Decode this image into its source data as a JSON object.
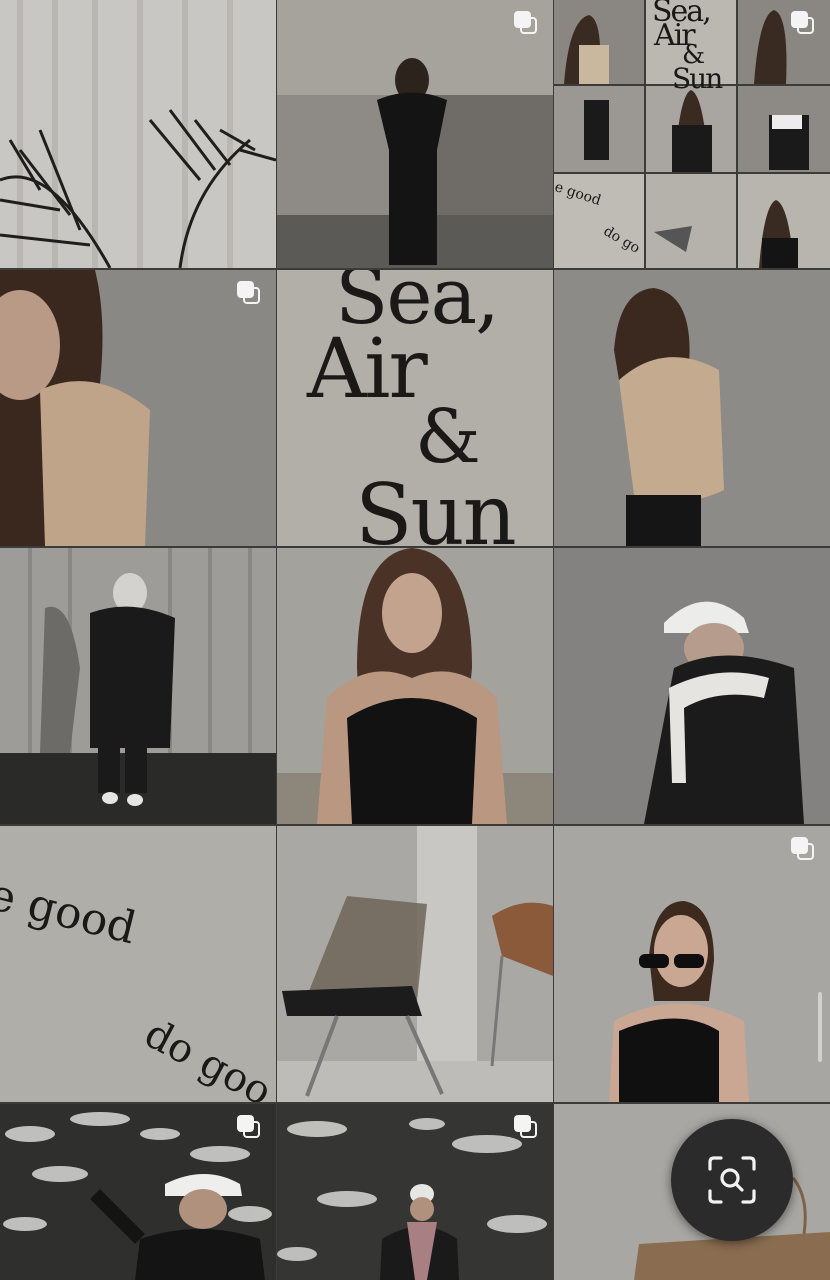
{
  "feed": {
    "tiles": [
      {
        "id": "r1c1",
        "subject": "curtain and palm",
        "multi": false
      },
      {
        "id": "r1c2",
        "subject": "girl in black by stone wall",
        "multi": true
      },
      {
        "id": "r1c3",
        "subject": "collage grid preview",
        "multi": true
      },
      {
        "id": "r2c1",
        "subject": "girl in beige hoodie",
        "multi": true
      },
      {
        "id": "r2c2",
        "subject": "typography poster",
        "multi": false
      },
      {
        "id": "r2c3",
        "subject": "girl in beige hoodie side",
        "multi": false
      },
      {
        "id": "r3c1",
        "subject": "puffer jacket outfit",
        "multi": false
      },
      {
        "id": "r3c2",
        "subject": "girl in black top",
        "multi": false
      },
      {
        "id": "r3c3",
        "subject": "white cap and sweater",
        "multi": false
      },
      {
        "id": "r4c1",
        "subject": "circular typography",
        "multi": false
      },
      {
        "id": "r4c2",
        "subject": "smoked acrylic chair",
        "multi": false
      },
      {
        "id": "r4c3",
        "subject": "girl with sunglasses",
        "multi": true
      },
      {
        "id": "r5c1",
        "subject": "snowy pine portrait",
        "multi": true
      },
      {
        "id": "r5c2",
        "subject": "snowy pine full body",
        "multi": true
      },
      {
        "id": "r5c3",
        "subject": "paper bag still life",
        "multi": false
      }
    ],
    "poster": {
      "line1": "Sea,",
      "line2": "Air",
      "line3": "&",
      "line4": "Sun"
    },
    "arc_text": {
      "top": "e good",
      "bottom": "do goo"
    },
    "mini_poster": {
      "line1": "Sea,",
      "line2": "Air",
      "line3": "&",
      "line4": "Sun"
    },
    "mini_arc": {
      "top": "e good",
      "bottom": "do go"
    }
  },
  "overlay": {
    "lens_button_icon": "visual-search-icon",
    "scrollbar": "vertical-scrollbar"
  },
  "colors": {
    "background": "#4a4a48",
    "multi_icon": "#f4f4f4",
    "lens_button": "#2b2b2b"
  }
}
